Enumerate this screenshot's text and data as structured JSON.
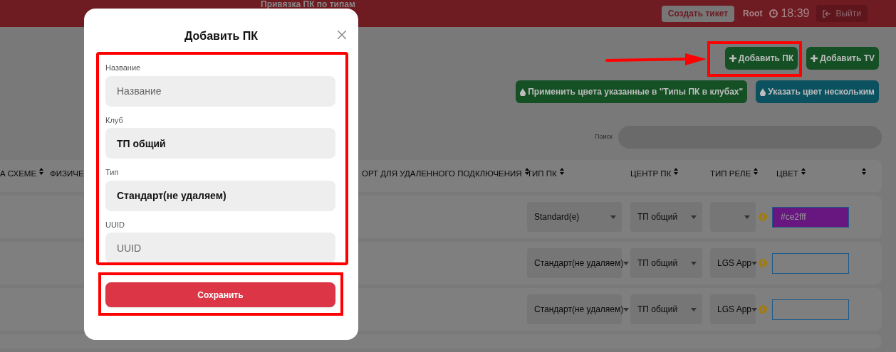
{
  "header": {
    "title": "Привязка ПК по типам",
    "ticket_button": "Создать тикет",
    "user": "Root",
    "time": "18:39",
    "logout_button": "Выйти"
  },
  "actions": [
    [
      {
        "label": "Добавить ПК",
        "kind": "success"
      },
      {
        "label": "Добавить TV",
        "kind": "success"
      }
    ],
    [
      {
        "label": "Применить цвета указанные в \"Типы ПК в клубах\"",
        "kind": "success"
      },
      {
        "label": "Указать цвет нескольким",
        "kind": "info"
      }
    ]
  ],
  "search": {
    "label": "Поиск"
  },
  "table": {
    "columns": [
      "А СХЕМЕ",
      "ФИЗИЧЕ",
      "ОРТ ДЛЯ УДАЛЕННОГО ПОДКЛЮЧЕНИЯ",
      "ТИП ПК",
      "ЦЕНТР ПК",
      "ТИП РЕЛЕ",
      "ЦВЕТ"
    ],
    "rows": [
      {
        "type": "Standard(e)",
        "center": "ТП общий",
        "color_value": "#ce2fff",
        "color": "#67177f"
      },
      {
        "type": "Стандарт(не удаляем)",
        "center": "ТП общий",
        "relay": "LGS App"
      },
      {
        "type": "Стандарт(не удаляем)",
        "center": "ТП общий",
        "relay": "LGS App"
      }
    ]
  },
  "modal": {
    "title": "Добавить ПК",
    "fields": [
      {
        "label": "Название",
        "placeholder": "Название"
      },
      {
        "label": "Клуб",
        "value": "ТП общий"
      },
      {
        "label": "Тип",
        "value": "Стандарт(не удаляем)"
      },
      {
        "label": "UUID",
        "placeholder": "UUID"
      }
    ],
    "save_button": "Сохранить"
  }
}
